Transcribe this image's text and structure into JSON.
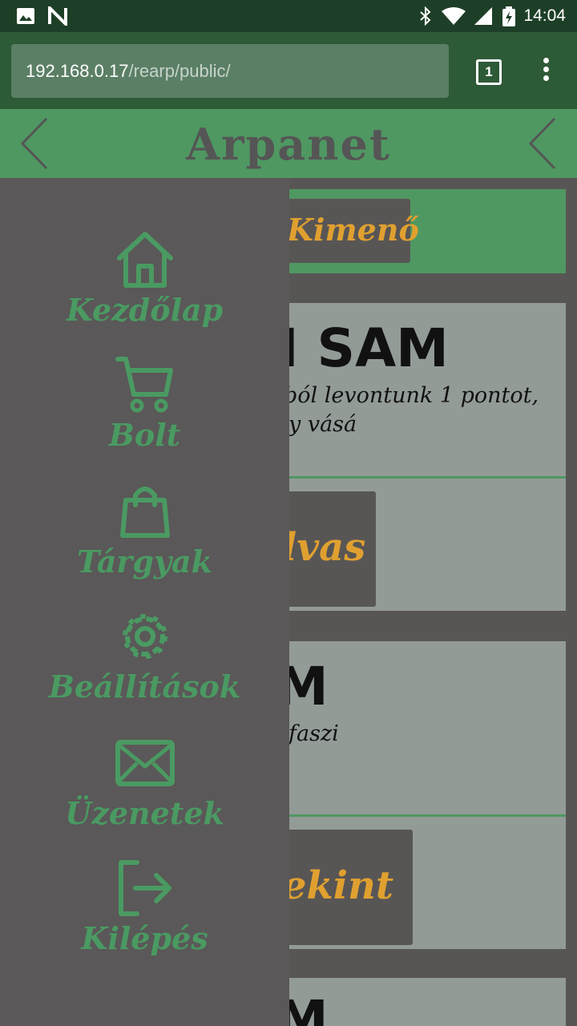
{
  "status_bar": {
    "time": "14:04"
  },
  "browser": {
    "url_host": "192.168.0.17",
    "url_path": "/rearp/public/",
    "tab_count": "1"
  },
  "app": {
    "title": "Arpanet"
  },
  "content": {
    "outgoing_label": "Kimenő",
    "card1_title": "I SAM",
    "card1_line1": "ból levontunk 1 pontot,",
    "card1_line2": "y vásá",
    "card1_button": "lvas",
    "card2_title": "M",
    "card2_line1": "faszi",
    "card2_button": "ekint",
    "card3_title": "M"
  },
  "drawer": {
    "items": [
      {
        "label": "Kezdőlap",
        "icon": "home-icon"
      },
      {
        "label": "Bolt",
        "icon": "cart-icon"
      },
      {
        "label": "Tárgyak",
        "icon": "bag-icon"
      },
      {
        "label": "Beállítások",
        "icon": "gear-icon"
      },
      {
        "label": "Üzenetek",
        "icon": "mail-icon"
      },
      {
        "label": "Kilépés",
        "icon": "logout-icon"
      }
    ]
  },
  "colors": {
    "accent_green": "#4f9862",
    "button_text": "#e0a030",
    "dark_bg": "#5a5858",
    "card_grey": "#939b97"
  }
}
